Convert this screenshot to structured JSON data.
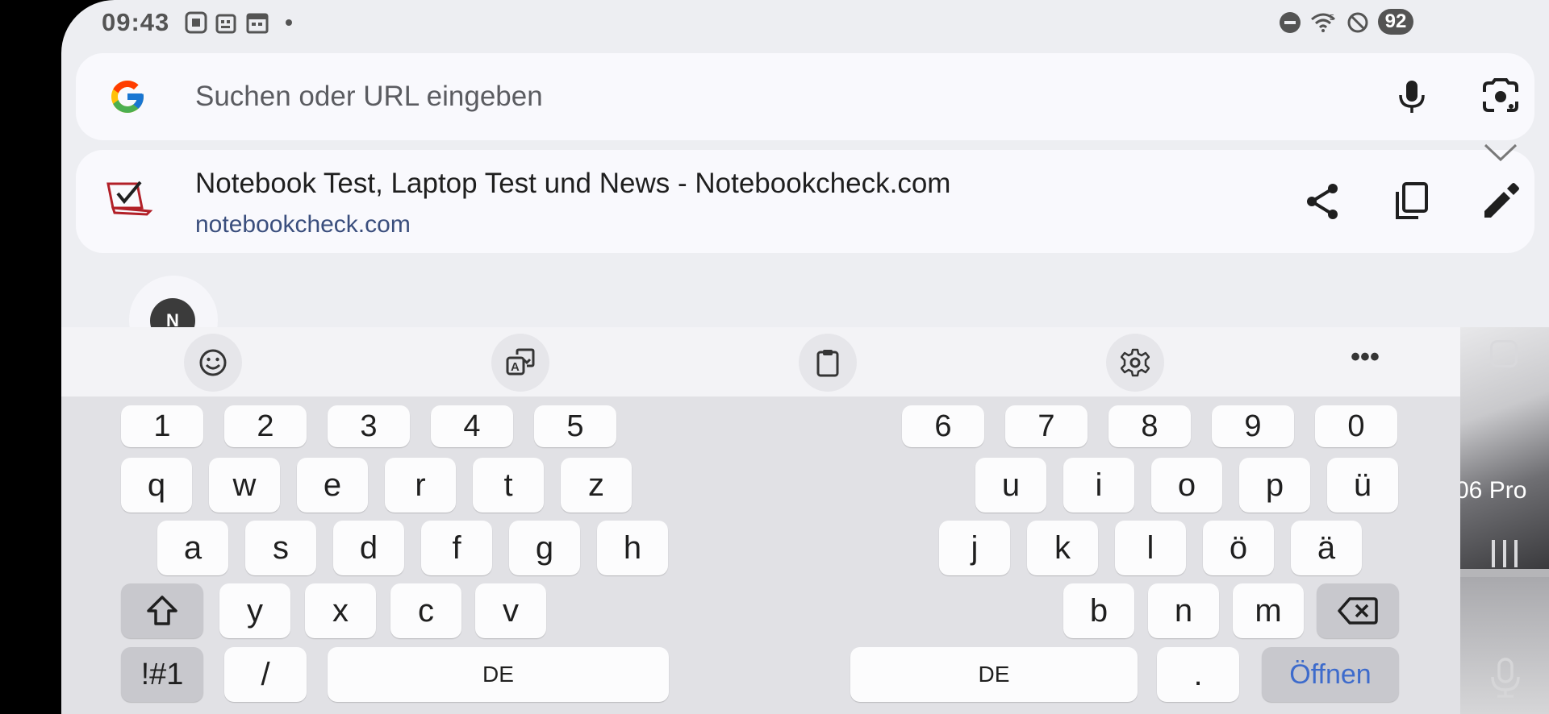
{
  "status_bar": {
    "time": "09:43",
    "battery": "92"
  },
  "search": {
    "placeholder": "Suchen oder URL eingeben"
  },
  "suggestion": {
    "title": "Notebook Test, Laptop Test und News - Notebookcheck.com",
    "url": "notebookcheck.com"
  },
  "shortcut_tile": {
    "avatar_letter": "N"
  },
  "recent_preview": {
    "text": "06 Pro"
  },
  "keyboard": {
    "number_row_left": [
      "1",
      "2",
      "3",
      "4",
      "5"
    ],
    "number_row_right": [
      "6",
      "7",
      "8",
      "9",
      "0"
    ],
    "row1_left": [
      "q",
      "w",
      "e",
      "r",
      "t",
      "z"
    ],
    "row1_right": [
      "u",
      "i",
      "o",
      "p",
      "ü"
    ],
    "row2_left": [
      "a",
      "s",
      "d",
      "f",
      "g",
      "h"
    ],
    "row2_right": [
      "j",
      "k",
      "l",
      "ö",
      "ä"
    ],
    "row3_left": [
      "y",
      "x",
      "c",
      "v"
    ],
    "row3_right": [
      "b",
      "n",
      "m"
    ],
    "symbols_label": "!#1",
    "slash_label": "/",
    "space_left_label": "DE",
    "space_right_label": "DE",
    "period_label": ".",
    "enter_label": "Öffnen"
  },
  "colors": {
    "accent_blue": "#3d6bcc",
    "url_color": "#3a4e7d",
    "background": "#edeef2"
  }
}
